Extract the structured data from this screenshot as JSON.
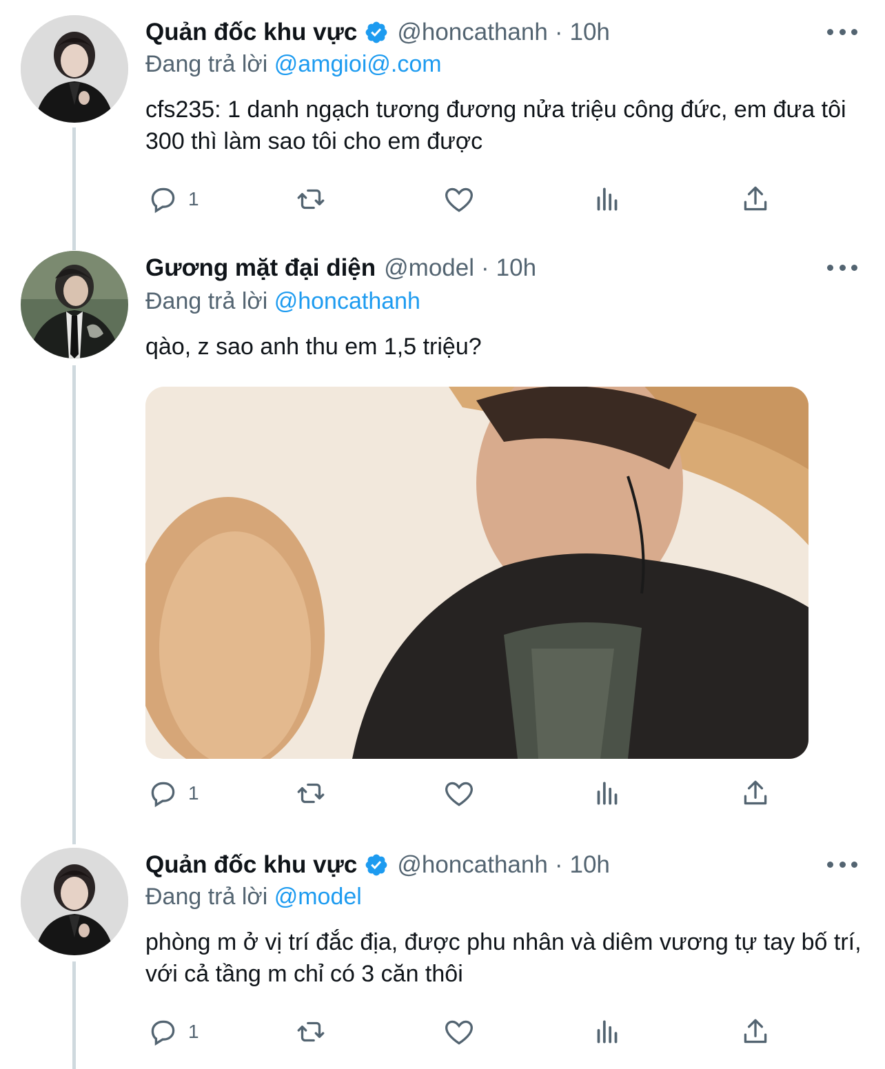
{
  "tweets": [
    {
      "name": "Quản đốc khu vực",
      "verified": true,
      "handle": "@honcathanh",
      "separator": "·",
      "time": "10h",
      "reply_prefix": "Đang trả lời",
      "reply_to": "@amgioi@.com",
      "text": "cfs235: 1 danh ngạch tương đương nửa triệu công đức, em đưa tôi 300 thì làm sao tôi cho em được",
      "reply_count": "1"
    },
    {
      "name": "Gương mặt đại diện",
      "verified": false,
      "handle": "@model",
      "separator": "·",
      "time": "10h",
      "reply_prefix": "Đang trả lời",
      "reply_to": "@honcathanh",
      "text": "qào, z sao anh thu em 1,5 triệu?",
      "reply_count": "1"
    },
    {
      "name": "Quản đốc khu vực",
      "verified": true,
      "handle": "@honcathanh",
      "separator": "·",
      "time": "10h",
      "reply_prefix": "Đang trả lời",
      "reply_to": "@model",
      "text": "phòng m ở vị trí đắc địa, được phu nhân và diêm vương tự tay bố trí, với cả tầng m chỉ có 3 căn thôi",
      "reply_count": "1"
    }
  ],
  "icons": {
    "reply": "speech-bubble-icon",
    "retweet": "retweet-icon",
    "like": "heart-icon",
    "views": "bar-chart-icon",
    "share": "share-upload-icon",
    "more": "more-dots-icon",
    "verified": "verified-badge-icon"
  },
  "colors": {
    "accent": "#1d9bf0",
    "secondary_text": "#536471",
    "thread_line": "#cfd9de"
  }
}
